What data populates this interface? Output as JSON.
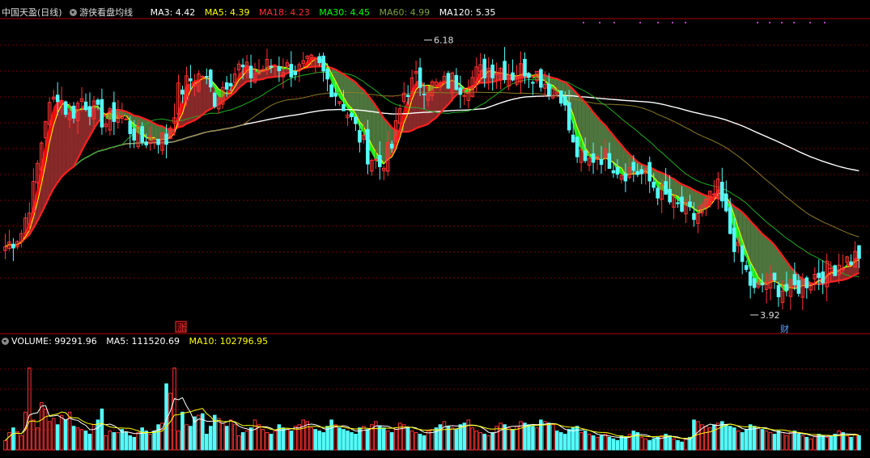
{
  "header": {
    "stock_label": "中国天盈(日线)",
    "indicator_label": "游侠看盘均线",
    "ma_items": [
      {
        "label": "MA3: 4.42",
        "color": "#ffffff"
      },
      {
        "label": "MA5: 4.39",
        "color": "#ffff00"
      },
      {
        "label": "MA18: 4.23",
        "color": "#ff3030"
      },
      {
        "label": "MA30: 4.45",
        "color": "#00ff00"
      },
      {
        "label": "MA60: 4.99",
        "color": "#7f9f3f"
      },
      {
        "label": "MA120: 5.35",
        "color": "#ffffff"
      }
    ]
  },
  "volume_header": {
    "items": [
      {
        "label": "VOLUME: 99291.96",
        "color": "#ffffff"
      },
      {
        "label": "MA5: 111520.69",
        "color": "#ffffff"
      },
      {
        "label": "MA10: 102796.95",
        "color": "#ffff00"
      }
    ]
  },
  "annotations": {
    "high_label": "6.18",
    "low_label": "3.92",
    "zhang_marker": "涨",
    "cai_marker": "财"
  },
  "colors": {
    "up": "#ff3232",
    "down": "#54fcfc",
    "grid": "#7a0000",
    "ma120": "#ffffff",
    "ma60": "#8c7a28",
    "ma30": "#22aa22"
  },
  "chart_data": [
    {
      "type": "candlestick",
      "title": "中国天盈(日线)",
      "ylim": [
        3.8,
        6.35
      ],
      "high": 6.18,
      "low": 3.92,
      "series": [
        {
          "name": "MA3",
          "value": 4.42
        },
        {
          "name": "MA5",
          "value": 4.39
        },
        {
          "name": "MA18",
          "value": 4.23
        },
        {
          "name": "MA30",
          "value": 4.45
        },
        {
          "name": "MA60",
          "value": 4.99
        },
        {
          "name": "MA120",
          "value": 5.35
        }
      ],
      "close_path": [
        [
          0,
          4.48
        ],
        [
          4,
          4.6
        ],
        [
          7,
          4.95
        ],
        [
          10,
          5.55
        ],
        [
          13,
          5.75
        ],
        [
          16,
          5.55
        ],
        [
          19,
          5.7
        ],
        [
          22,
          5.6
        ],
        [
          25,
          5.5
        ],
        [
          28,
          5.6
        ],
        [
          31,
          5.45
        ],
        [
          34,
          5.35
        ],
        [
          37,
          5.4
        ],
        [
          40,
          5.35
        ],
        [
          43,
          5.75
        ],
        [
          46,
          5.85
        ],
        [
          49,
          5.9
        ],
        [
          52,
          5.7
        ],
        [
          55,
          5.85
        ],
        [
          58,
          5.95
        ],
        [
          61,
          5.9
        ],
        [
          64,
          5.95
        ],
        [
          67,
          5.98
        ],
        [
          70,
          5.95
        ],
        [
          73,
          5.93
        ],
        [
          76,
          5.98
        ],
        [
          78,
          5.95
        ],
        [
          81,
          5.8
        ],
        [
          84,
          5.65
        ],
        [
          87,
          5.45
        ],
        [
          90,
          5.25
        ],
        [
          93,
          5.15
        ],
        [
          96,
          5.3
        ],
        [
          99,
          5.75
        ],
        [
          102,
          5.85
        ],
        [
          105,
          5.8
        ],
        [
          108,
          5.8
        ],
        [
          111,
          5.85
        ],
        [
          114,
          5.8
        ],
        [
          117,
          5.9
        ],
        [
          120,
          5.95
        ],
        [
          123,
          5.95
        ],
        [
          126,
          5.9
        ],
        [
          129,
          5.95
        ],
        [
          132,
          5.9
        ],
        [
          135,
          5.8
        ],
        [
          138,
          5.75
        ],
        [
          141,
          5.3
        ],
        [
          144,
          5.15
        ],
        [
          147,
          5.25
        ],
        [
          150,
          5.2
        ],
        [
          153,
          5.1
        ],
        [
          156,
          5.12
        ],
        [
          159,
          5.05
        ],
        [
          162,
          4.95
        ],
        [
          165,
          4.85
        ],
        [
          168,
          4.78
        ],
        [
          171,
          4.72
        ],
        [
          174,
          4.82
        ],
        [
          177,
          4.95
        ],
        [
          180,
          4.6
        ],
        [
          183,
          4.35
        ],
        [
          186,
          4.1
        ],
        [
          189,
          4.2
        ],
        [
          192,
          4.15
        ],
        [
          195,
          4.12
        ],
        [
          198,
          4.18
        ],
        [
          201,
          4.25
        ],
        [
          204,
          4.28
        ],
        [
          207,
          4.35
        ],
        [
          210,
          4.38
        ],
        [
          212,
          4.42
        ]
      ]
    },
    {
      "type": "bar",
      "title": "VOLUME",
      "ylim": [
        0,
        300000
      ],
      "series": [
        {
          "name": "VOLUME",
          "value": 99291.96
        },
        {
          "name": "MA5",
          "value": 111520.69
        },
        {
          "name": "MA10",
          "value": 102796.95
        }
      ],
      "values": [
        30000,
        55000,
        70000,
        58000,
        45000,
        120000,
        260000,
        95000,
        70000,
        150000,
        130000,
        90000,
        100000,
        80000,
        110000,
        95000,
        120000,
        75000,
        70000,
        65000,
        60000,
        50000,
        80000,
        95000,
        130000,
        45000,
        60000,
        55000,
        55000,
        65000,
        55000,
        45000,
        40000,
        55000,
        70000,
        60000,
        50000,
        60000,
        80000,
        85000,
        210000,
        180000,
        260000,
        60000,
        120000,
        80000,
        75000,
        105000,
        110000,
        115000,
        50000,
        75000,
        110000,
        100000,
        85000,
        75000,
        95000,
        80000,
        45000,
        55000,
        60000,
        70000,
        95000,
        80000,
        65000,
        55000,
        50000,
        60000,
        80000,
        70000,
        65000,
        60000,
        75000,
        80000,
        95000,
        90000,
        70000,
        65000,
        60000,
        55000,
        75000,
        95000,
        80000,
        70000,
        65000,
        60000,
        55000,
        50000,
        70000,
        75000,
        65000,
        80000,
        90000,
        75000,
        70000,
        60000,
        55000,
        65000,
        85000,
        80000,
        70000,
        60000,
        55000,
        50000,
        45000,
        60000,
        65000,
        70000,
        80000,
        90000,
        75000,
        70000,
        65000,
        80000,
        85000,
        95000,
        70000,
        60000,
        55000,
        50000,
        45000,
        55000,
        75000,
        85000,
        80000,
        70000,
        65000,
        75000,
        90000,
        85000,
        80000,
        75000,
        70000,
        95000,
        90000,
        85000,
        80000,
        60000,
        55000,
        50000,
        65000,
        70000,
        75000,
        55000,
        60000,
        50000,
        45000,
        40000,
        45000,
        50000,
        40000,
        35000,
        30000,
        45000,
        40000,
        50000,
        60000,
        55000,
        40000,
        35000,
        30000,
        35000,
        40000,
        45000,
        50000,
        45000,
        35000,
        30000,
        25000,
        35000,
        40000,
        95000,
        90000,
        80000,
        75000,
        70000,
        80000,
        85000,
        90000,
        80000,
        75000,
        70000,
        60000,
        55000,
        65000,
        80000,
        75000,
        70000,
        65000,
        60000,
        55000,
        50000,
        60000,
        55000,
        45000,
        55000,
        60000,
        50000,
        45000,
        40000,
        35000,
        45000,
        50000,
        45000,
        40000,
        45000,
        50000,
        60000,
        55000,
        45000,
        40000,
        50000,
        45000
      ]
    }
  ]
}
